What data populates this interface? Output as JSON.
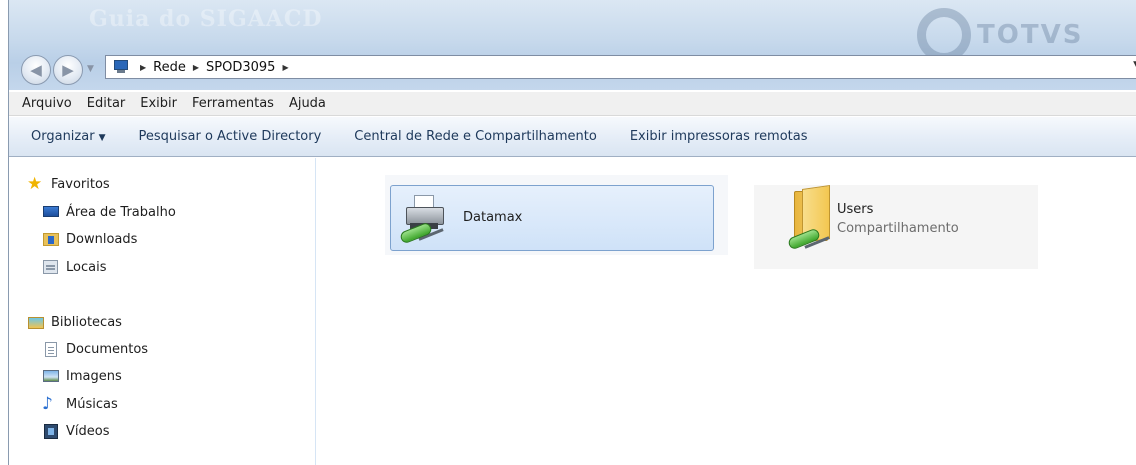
{
  "titlebar": {
    "watermark_text": "Guia do SIGAACD",
    "brand_text": "TOTVS"
  },
  "address": {
    "crumbs": [
      "Rede",
      "SPOD3095"
    ]
  },
  "menubar": {
    "items": [
      "Arquivo",
      "Editar",
      "Exibir",
      "Ferramentas",
      "Ajuda"
    ]
  },
  "commandbar": {
    "organize": "Organizar",
    "search_ad": "Pesquisar o Active Directory",
    "network_center": "Central de Rede e Compartilhamento",
    "remote_printers": "Exibir impressoras remotas"
  },
  "navpane": {
    "favorites": {
      "title": "Favoritos",
      "items": [
        "Área de Trabalho",
        "Downloads",
        "Locais"
      ]
    },
    "libraries": {
      "title": "Bibliotecas",
      "items": [
        "Documentos",
        "Imagens",
        "Músicas",
        "Vídeos"
      ]
    }
  },
  "content": {
    "items": [
      {
        "name": "Datamax",
        "subtitle": "",
        "icon": "printer-icon",
        "selected": true
      },
      {
        "name": "Users",
        "subtitle": "Compartilhamento",
        "icon": "shared-folder-icon",
        "selected": false
      }
    ]
  },
  "colors": {
    "command_text": "#1e395b",
    "selection_border": "#7da2ce",
    "glass": "#c7d9ec"
  }
}
